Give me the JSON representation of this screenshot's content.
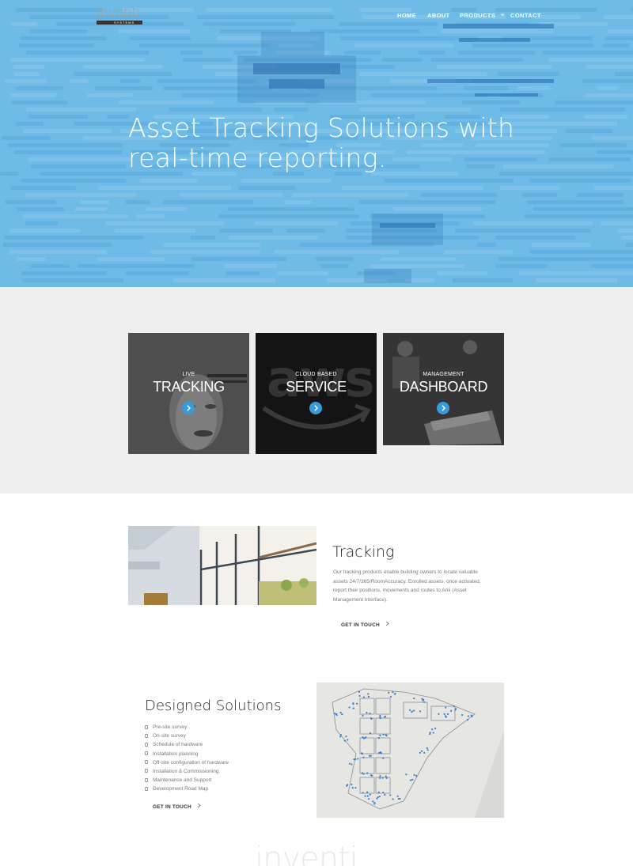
{
  "header": {
    "logo_text": "inventi",
    "logo_sub": "SYSTEMS",
    "nav": [
      {
        "label": "HOME"
      },
      {
        "label": "ABOUT"
      },
      {
        "label": "PRODUCTS"
      },
      {
        "label": "CONTACT"
      }
    ]
  },
  "hero": {
    "title_line1": "Asset Tracking Solutions with",
    "title_line2": "real-time reporting."
  },
  "cards": [
    {
      "small": "LIVE",
      "big": "TRACKING"
    },
    {
      "small": "CLOUD BASED",
      "big": "SERVICE",
      "bg_text": "aws"
    },
    {
      "small": "MANAGEMENT",
      "big": "DASHBOARD"
    }
  ],
  "tracking": {
    "title": "Tracking",
    "body": "Our tracking products enable building owners to locate valuable assets 24/7/365/RoomAccuracy. Enrolled assets, once activated, report their positions, movements and routes to Ami (Asset Management Interface).",
    "cta": "GET IN TOUCH"
  },
  "solutions": {
    "title": "Designed Solutions",
    "items": [
      "Pre-site survey",
      "On-site survey",
      "Schedule of hardware",
      "Installation planning",
      "Off-site configuration of hardware",
      "Installation & Commissioning",
      "Maintenance and Support",
      "Development Road Map"
    ],
    "cta": "GET IN TOUCH"
  },
  "footer": {
    "logo_text": "inventi"
  },
  "colors": {
    "hero_blue": "#6fbbe7",
    "accent": "#3a9bdc",
    "section_grey": "#efefef"
  }
}
